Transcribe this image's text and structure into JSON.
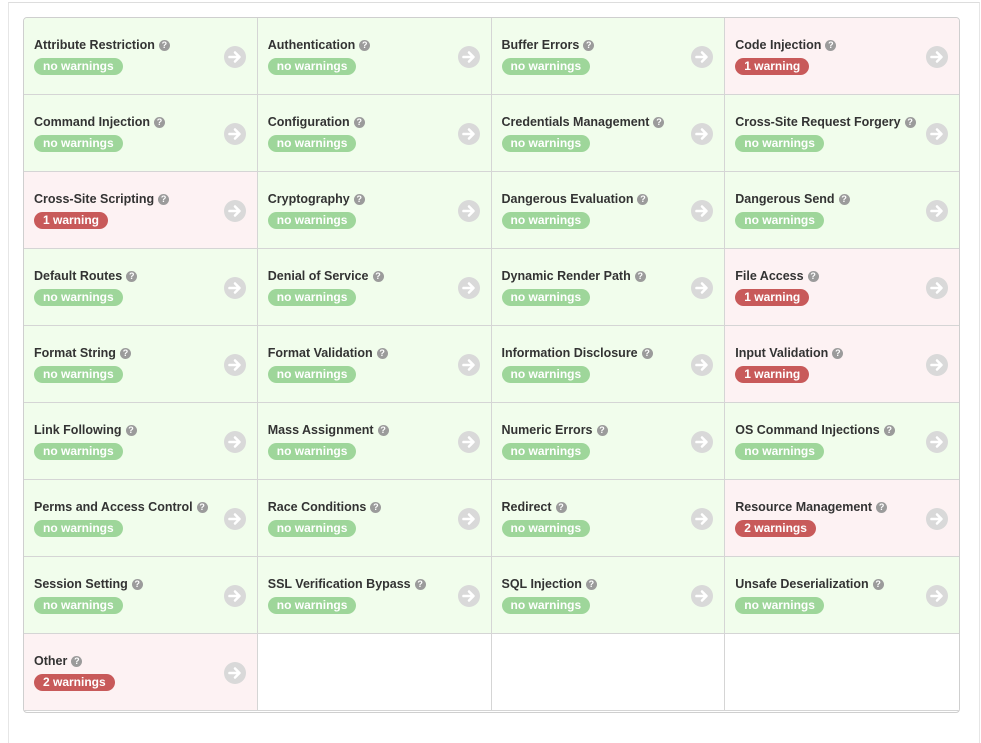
{
  "colors": {
    "ok_bg": "#f1fdec",
    "warn_bg": "#fdf2f3",
    "ok_badge": "#9ed69a",
    "warn_badge": "#c85a5a",
    "arrow": "#d9d9d9"
  },
  "icons": {
    "help": "question-circle-icon",
    "go": "arrow-right-circle-icon"
  },
  "help_glyph": "?",
  "categories": [
    {
      "name": "Attribute Restriction",
      "status": "no warnings",
      "warn": false
    },
    {
      "name": "Authentication",
      "status": "no warnings",
      "warn": false
    },
    {
      "name": "Buffer Errors",
      "status": "no warnings",
      "warn": false
    },
    {
      "name": "Code Injection",
      "status": "1 warning",
      "warn": true
    },
    {
      "name": "Command Injection",
      "status": "no warnings",
      "warn": false
    },
    {
      "name": "Configuration",
      "status": "no warnings",
      "warn": false
    },
    {
      "name": "Credentials Management",
      "status": "no warnings",
      "warn": false
    },
    {
      "name": "Cross-Site Request Forgery",
      "status": "no warnings",
      "warn": false
    },
    {
      "name": "Cross-Site Scripting",
      "status": "1 warning",
      "warn": true
    },
    {
      "name": "Cryptography",
      "status": "no warnings",
      "warn": false
    },
    {
      "name": "Dangerous Evaluation",
      "status": "no warnings",
      "warn": false
    },
    {
      "name": "Dangerous Send",
      "status": "no warnings",
      "warn": false
    },
    {
      "name": "Default Routes",
      "status": "no warnings",
      "warn": false
    },
    {
      "name": "Denial of Service",
      "status": "no warnings",
      "warn": false
    },
    {
      "name": "Dynamic Render Path",
      "status": "no warnings",
      "warn": false
    },
    {
      "name": "File Access",
      "status": "1 warning",
      "warn": true
    },
    {
      "name": "Format String",
      "status": "no warnings",
      "warn": false
    },
    {
      "name": "Format Validation",
      "status": "no warnings",
      "warn": false
    },
    {
      "name": "Information Disclosure",
      "status": "no warnings",
      "warn": false
    },
    {
      "name": "Input Validation",
      "status": "1 warning",
      "warn": true
    },
    {
      "name": "Link Following",
      "status": "no warnings",
      "warn": false
    },
    {
      "name": "Mass Assignment",
      "status": "no warnings",
      "warn": false
    },
    {
      "name": "Numeric Errors",
      "status": "no warnings",
      "warn": false
    },
    {
      "name": "OS Command Injections",
      "status": "no warnings",
      "warn": false
    },
    {
      "name": "Perms and Access Control",
      "status": "no warnings",
      "warn": false
    },
    {
      "name": "Race Conditions",
      "status": "no warnings",
      "warn": false
    },
    {
      "name": "Redirect",
      "status": "no warnings",
      "warn": false
    },
    {
      "name": "Resource Management",
      "status": "2 warnings",
      "warn": true
    },
    {
      "name": "Session Setting",
      "status": "no warnings",
      "warn": false
    },
    {
      "name": "SSL Verification Bypass",
      "status": "no warnings",
      "warn": false
    },
    {
      "name": "SQL Injection",
      "status": "no warnings",
      "warn": false
    },
    {
      "name": "Unsafe Deserialization",
      "status": "no warnings",
      "warn": false
    },
    {
      "name": "Other",
      "status": "2 warnings",
      "warn": true
    }
  ]
}
